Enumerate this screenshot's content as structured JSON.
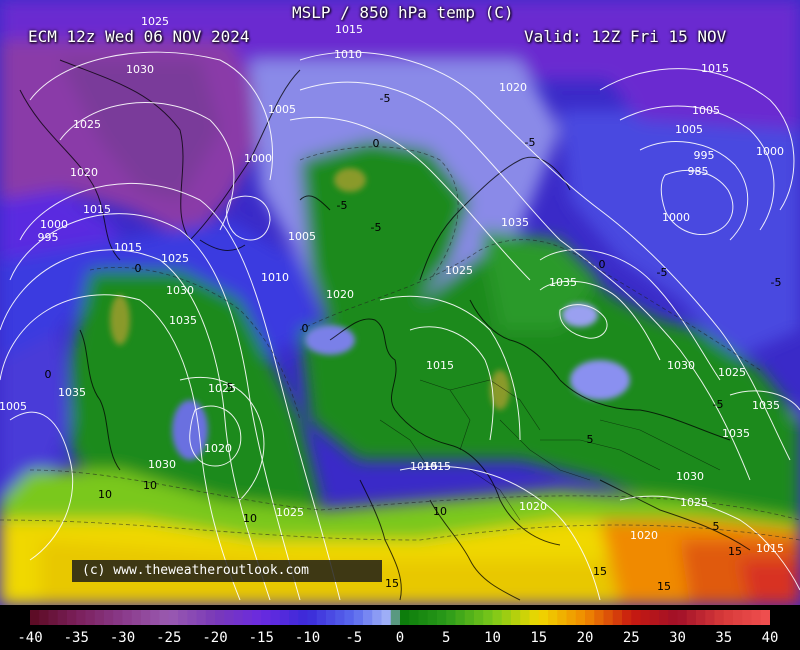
{
  "header": {
    "title": "MSLP / 850 hPa temp (C)",
    "model_run": "ECM 12z Wed 06 NOV 2024",
    "valid": "Valid: 12Z Fri 15 NOV"
  },
  "credit": "(c) www.theweatheroutlook.com",
  "colorbar": {
    "tick_labels": [
      "-40",
      "-35",
      "-30",
      "-25",
      "-20",
      "-15",
      "-10",
      "-5",
      "0",
      "5",
      "10",
      "15",
      "20",
      "25",
      "30",
      "35",
      "40"
    ],
    "stops": [
      {
        "t": -40,
        "color": "#5a0a20"
      },
      {
        "t": -35,
        "color": "#7a1f5a"
      },
      {
        "t": -30,
        "color": "#8a3a8a"
      },
      {
        "t": -25,
        "color": "#9a5ab0"
      },
      {
        "t": -20,
        "color": "#7a3ab8"
      },
      {
        "t": -15,
        "color": "#6a2ae0"
      },
      {
        "t": -10,
        "color": "#3a2ad8"
      },
      {
        "t": -5,
        "color": "#5a6aee"
      },
      {
        "t": -1,
        "color": "#a8b8f8"
      },
      {
        "t": 0,
        "color": "#0a7a0a"
      },
      {
        "t": 5,
        "color": "#2a9a1a"
      },
      {
        "t": 10,
        "color": "#7ac81a"
      },
      {
        "t": 15,
        "color": "#f0d800"
      },
      {
        "t": 20,
        "color": "#f08a00"
      },
      {
        "t": 25,
        "color": "#c81a10"
      },
      {
        "t": 30,
        "color": "#a01028"
      },
      {
        "t": 35,
        "color": "#d83a3a"
      },
      {
        "t": 40,
        "color": "#f05050"
      }
    ]
  },
  "isobar_labels": [
    "1025",
    "1030",
    "1025",
    "1020",
    "1015",
    "1000",
    "995",
    "1015",
    "1010",
    "1005",
    "1000",
    "1005",
    "1010",
    "1020",
    "1025",
    "1030",
    "1035",
    "1035",
    "1020",
    "1015",
    "1025",
    "1035",
    "1030",
    "1025",
    "1015",
    "1010",
    "1005",
    "995",
    "985",
    "1000",
    "1000",
    "1000",
    "1025",
    "1035",
    "1030",
    "1035",
    "1025",
    "1030",
    "1005",
    "1005",
    "1025",
    "1020",
    "1030",
    "1025",
    "1020",
    "1015",
    "1020",
    "1025",
    "1015"
  ],
  "temperature_labels": [
    "-5",
    "-5",
    "-5",
    "-5",
    "-5",
    "-5",
    "-5",
    "0",
    "0",
    "0",
    "0",
    "0",
    "5",
    "5",
    "5",
    "10",
    "10",
    "10",
    "10",
    "15",
    "15",
    "15",
    "15"
  ]
}
